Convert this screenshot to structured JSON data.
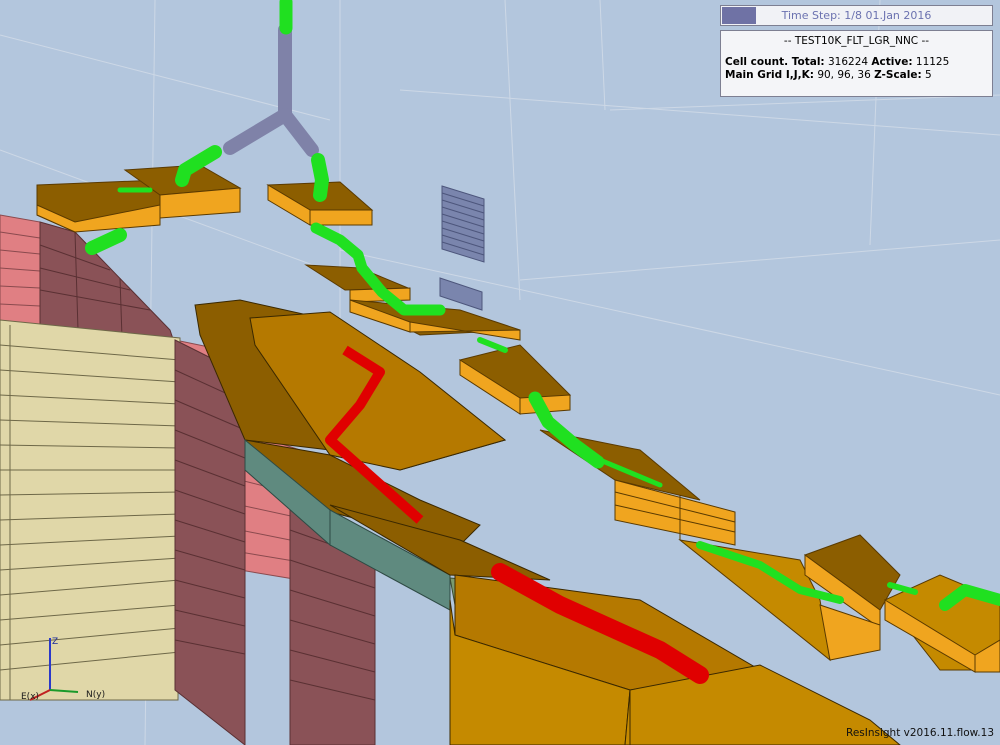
{
  "app": {
    "version": "ResInsight v2016.11.flow.13"
  },
  "timestep": {
    "label": "Time Step: 1/8 01.Jan 2016",
    "progress": 0.125
  },
  "info": {
    "case_name": "-- TEST10K_FLT_LGR_NNC --",
    "cell_count_label": "Cell count. Total:",
    "cell_total": "316224",
    "active_label": "Active:",
    "active_count": "11125",
    "grid_label": "Main Grid I,J,K:",
    "grid_dims": "90, 96, 36",
    "zscale_label": "Z-Scale:",
    "zscale": "5"
  },
  "axis": {
    "z_label": "Z",
    "x_label": "E(x)",
    "y_label": "N(y)"
  },
  "colors": {
    "background": "#b3c6dd",
    "well_pipe_open": "#20e020",
    "well_pipe_trunk": "#7f82a8",
    "cell_orange": "#f0a51f",
    "cell_brown": "#8c5e00",
    "fault_pink": "#e07f83",
    "fault_maroon": "#8a5257",
    "cell_beige": "#e0d7a8",
    "nnc_teal": "#5f8a7f",
    "red_well": "#e00000"
  }
}
